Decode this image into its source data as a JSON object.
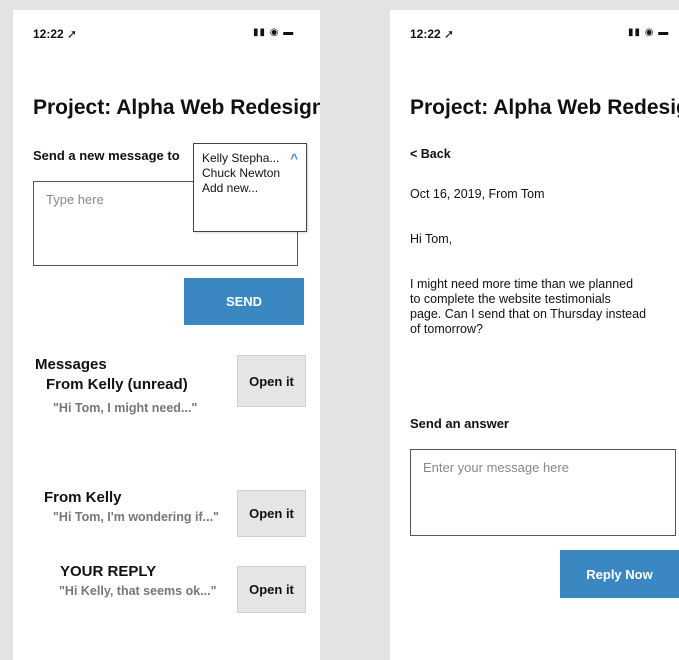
{
  "left_screen": {
    "status": {
      "time": "12:22 ➚",
      "icons": "▮▮ ◉ ▬"
    },
    "title": "Project: Alpha Web Redesign",
    "compose_label": "Send a new message to",
    "recipient_dropdown": {
      "options": [
        "Kelly Stepha...",
        "Chuck Newton",
        "Add new..."
      ],
      "chevron": "^"
    },
    "message_placeholder": "Type here",
    "send_button": "SEND",
    "messages_heading": "Messages",
    "messages": [
      {
        "from": "From Kelly (unread)",
        "preview": "\"Hi Tom, I might need...\"",
        "action": "Open it"
      },
      {
        "from": "From Kelly",
        "preview": "\"Hi Tom, I'm wondering if...\"",
        "action": "Open it"
      },
      {
        "from": "YOUR REPLY",
        "preview": "\"Hi Kelly, that seems ok...\"",
        "action": "Open it"
      }
    ]
  },
  "right_screen": {
    "status": {
      "time": "12:22 ➚",
      "icons": "▮▮ ◉ ▬"
    },
    "title": "Project: Alpha Web Redesign",
    "back_link": "< Back",
    "meta": "Oct 16, 2019, From Tom",
    "greeting": "Hi Tom,",
    "body_lines": [
      "I might need more time than we planned",
      "to complete the website testimonials",
      "page. Can I send that on Thursday instead",
      "of tomorrow?"
    ],
    "answer_label": "Send an answer",
    "answer_placeholder": "Enter your message here",
    "reply_button": "Reply Now"
  }
}
